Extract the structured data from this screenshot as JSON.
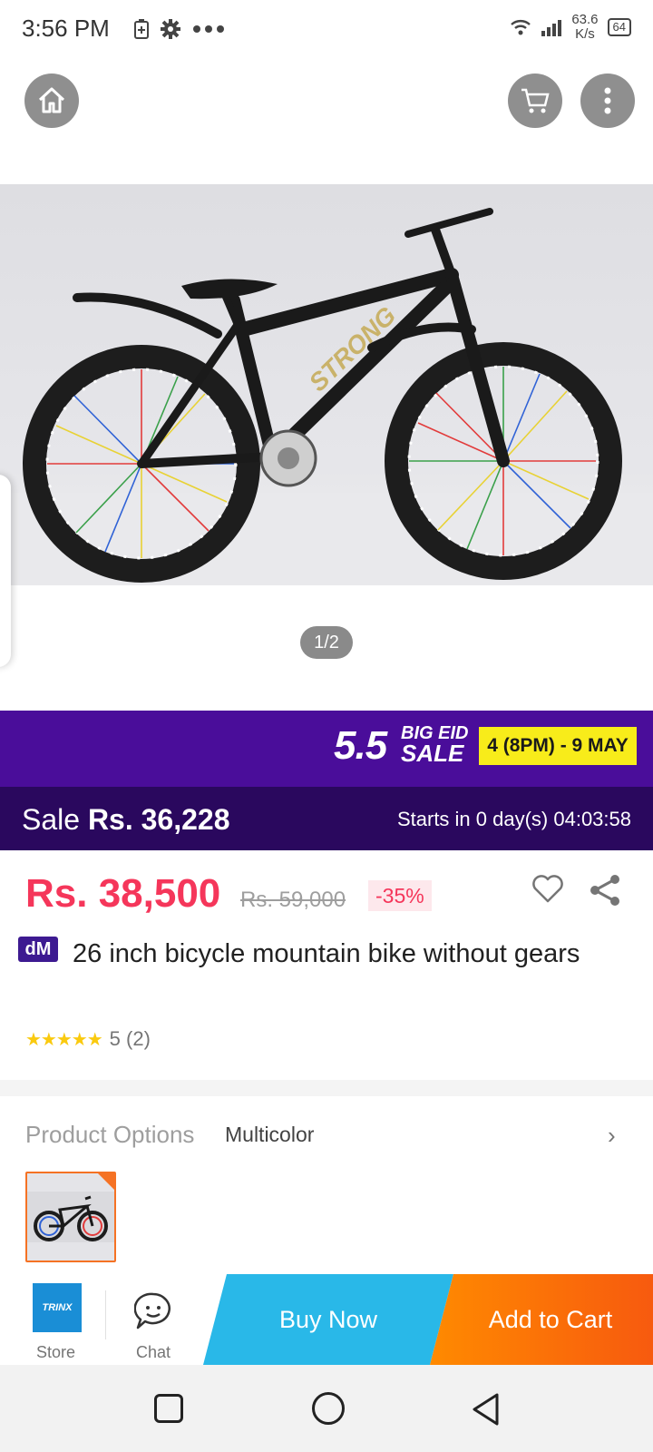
{
  "status_bar": {
    "time": "3:56 PM",
    "net_speed": "63.6",
    "net_unit": "K/s",
    "battery": "64"
  },
  "top_bar": {
    "home_icon": "home-icon",
    "cart_icon": "cart-icon",
    "more_icon": "more-vertical-icon"
  },
  "gallery": {
    "pager": "1/2",
    "brand_on_frame": "STRONG"
  },
  "campaign": {
    "number": "5.5",
    "line1": "BIG EID",
    "line2": "SALE",
    "dates": "4 (8PM) - 9 MAY",
    "bg_color": "#4a0d9a"
  },
  "sale_bar": {
    "prefix": "Sale",
    "price": "Rs. 36,228",
    "countdown": "Starts in 0 day(s) 04:03:58"
  },
  "price": {
    "current": "Rs. 38,500",
    "original": "Rs. 59,000",
    "discount": "-35%",
    "color": "#f5365a"
  },
  "product": {
    "badge": "dM",
    "title": "26 inch bicycle mountain bike without gears",
    "stars": "★★★★★",
    "rating": "5 (2)"
  },
  "options": {
    "label": "Product Options",
    "value": "Multicolor",
    "chevron": "›"
  },
  "action_bar": {
    "store_logo": "TRINX",
    "store_label": "Store",
    "chat_label": "Chat",
    "buy_now": "Buy Now",
    "add_to_cart": "Add to Cart",
    "buy_color": "#29b8e8",
    "cart_color": "#f75a0f"
  }
}
